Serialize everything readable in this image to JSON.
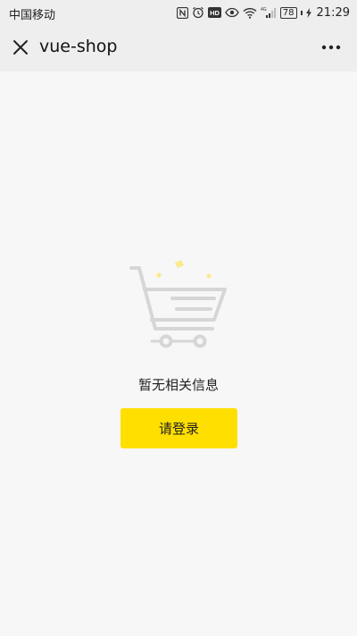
{
  "status_bar": {
    "carrier": "中国移动",
    "battery": "78",
    "network": "4G",
    "time": "21:29"
  },
  "nav": {
    "title": "vue-shop"
  },
  "empty_state": {
    "message": "暂无相关信息",
    "login_label": "请登录"
  },
  "colors": {
    "accent": "#ffdf00",
    "background": "#f7f7f7",
    "header": "#eeeeee",
    "illustration_gray": "#d6d6d6",
    "sparkle": "#fbe98c"
  }
}
